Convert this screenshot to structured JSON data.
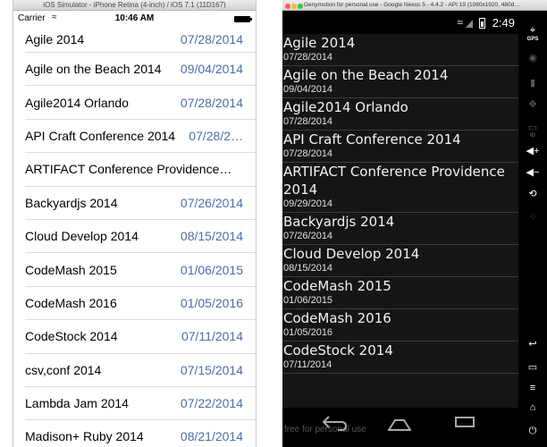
{
  "ios": {
    "window_title": "iOS Simulator - iPhone Retina (4-inch) / iOS 7.1 (11D167)",
    "status": {
      "carrier": "Carrier",
      "time": "10:46 AM"
    },
    "rows": [
      {
        "name": "Agile 2014",
        "date": "07/28/2014"
      },
      {
        "name": "Agile on the Beach 2014",
        "date": "09/04/2014"
      },
      {
        "name": "Agile2014 Orlando",
        "date": "07/28/2014"
      },
      {
        "name": "API Craft Conference 2014",
        "date": "07/28/2…"
      },
      {
        "name": "ARTIFACT Conference Providence…",
        "date": ""
      },
      {
        "name": "Backyardjs 2014",
        "date": "07/26/2014"
      },
      {
        "name": "Cloud Develop 2014",
        "date": "08/15/2014"
      },
      {
        "name": "CodeMash 2015",
        "date": "01/06/2015"
      },
      {
        "name": "CodeMash 2016",
        "date": "01/05/2016"
      },
      {
        "name": "CodeStock 2014",
        "date": "07/11/2014"
      },
      {
        "name": "csv,conf 2014",
        "date": "07/15/2014"
      },
      {
        "name": "Lambda Jam 2014",
        "date": "07/22/2014"
      },
      {
        "name": "Madison+ Ruby 2014",
        "date": "08/21/2014"
      }
    ]
  },
  "android": {
    "window_title": "Genymotion for personal use - Google Nexus 5 - 4.4.2 - API 19 (1080x1920, 480d…",
    "status": {
      "time": "2:49"
    },
    "rows": [
      {
        "name": "Agile 2014",
        "date": "07/28/2014"
      },
      {
        "name": "Agile on the Beach 2014",
        "date": "09/04/2014"
      },
      {
        "name": "Agile2014 Orlando",
        "date": "07/28/2014"
      },
      {
        "name": "API Craft Conference 2014",
        "date": "07/28/2014"
      },
      {
        "name": "ARTIFACT Conference Providence 2014",
        "date": "09/29/2014"
      },
      {
        "name": "Backyardjs 2014",
        "date": "07/26/2014"
      },
      {
        "name": "Cloud Develop 2014",
        "date": "08/15/2014"
      },
      {
        "name": "CodeMash 2015",
        "date": "01/06/2015"
      },
      {
        "name": "CodeMash 2016",
        "date": "01/05/2016"
      },
      {
        "name": "CodeStock 2014",
        "date": "07/11/2014"
      }
    ],
    "watermark": "free for personal use",
    "side_buttons": [
      {
        "icon": "gps-icon",
        "label": "GPS"
      },
      {
        "icon": "camera-icon",
        "label": ""
      },
      {
        "icon": "battery-icon",
        "label": ""
      },
      {
        "icon": "dpad-icon",
        "label": ""
      },
      {
        "icon": "id-icon",
        "label": "ID"
      },
      {
        "icon": "volume-up-icon",
        "label": ""
      },
      {
        "icon": "volume-down-icon",
        "label": ""
      },
      {
        "icon": "rotate-icon",
        "label": ""
      },
      {
        "icon": "pixel-perfect-icon",
        "label": ""
      },
      {
        "icon": "back-icon",
        "label": ""
      },
      {
        "icon": "recent-apps-icon",
        "label": ""
      },
      {
        "icon": "menu-icon",
        "label": ""
      },
      {
        "icon": "home-icon",
        "label": ""
      },
      {
        "icon": "power-icon",
        "label": ""
      }
    ]
  }
}
